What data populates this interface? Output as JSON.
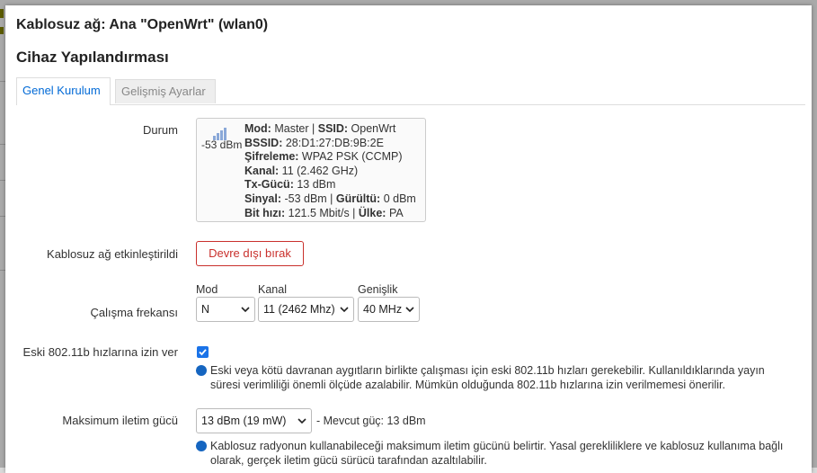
{
  "modal": {
    "title": "Kablosuz ağ: Ana \"OpenWrt\" (wlan0)",
    "section_title": "Cihaz Yapılandırması"
  },
  "tabs": [
    {
      "label": "Genel Kurulum",
      "active": true
    },
    {
      "label": "Gelişmiş Ayarlar",
      "active": false
    }
  ],
  "status": {
    "label": "Durum",
    "signal_dbm": "-53 dBm",
    "lines": [
      {
        "k1": "Mod:",
        "v1": " Master | ",
        "k2": "SSID:",
        "v2": " OpenWrt"
      },
      {
        "k1": "BSSID:",
        "v1": " 28:D1:27:DB:9B:2E",
        "k2": "",
        "v2": ""
      },
      {
        "k1": "Şifreleme:",
        "v1": " WPA2 PSK (CCMP)",
        "k2": "",
        "v2": ""
      },
      {
        "k1": "Kanal:",
        "v1": " 11 (2.462 GHz)",
        "k2": "",
        "v2": ""
      },
      {
        "k1": "Tx-Gücü:",
        "v1": " 13 dBm",
        "k2": "",
        "v2": ""
      },
      {
        "k1": "Sinyal:",
        "v1": " -53 dBm | ",
        "k2": "Gürültü:",
        "v2": " 0 dBm"
      },
      {
        "k1": "Bit hızı:",
        "v1": " 121.5 Mbit/s | ",
        "k2": "Ülke:",
        "v2": " PA"
      }
    ]
  },
  "enable": {
    "label": "Kablosuz ağ etkinleştirildi",
    "button_label": "Devre dışı bırak"
  },
  "frequency": {
    "label": "Çalışma frekansı",
    "mode_label": "Mod",
    "mode_value": "N",
    "channel_label": "Kanal",
    "channel_value": "11 (2462 Mhz)",
    "width_label": "Genişlik",
    "width_value": "40 MHz"
  },
  "legacy": {
    "label": "Eski 802.11b hızlarına izin ver",
    "checked": true,
    "help": "Eski veya kötü davranan aygıtların birlikte çalışması için eski 802.11b hızları gerekebilir. Kullanıldıklarında yayın süresi verimliliği önemli ölçüde azalabilir. Mümkün olduğunda 802.11b hızlarına izin verilmemesi önerilir."
  },
  "txpower": {
    "label": "Maksimum iletim gücü",
    "value": "13 dBm (19 mW)",
    "current_text": "- Mevcut güç: 13 dBm",
    "help": "Kablosuz radyonun kullanabileceği maksimum iletim gücünü belirtir. Yasal gerekliliklere ve kablosuz kullanıma bağlı olarak, gerçek iletim gücü sürücü tarafından azaltılabilir."
  },
  "colors": {
    "accent": "#0069d6",
    "danger": "#c9302c",
    "checkbox": "#1a73e8"
  },
  "icons": {
    "help": "question-circle-icon",
    "signal": "signal-bars-icon",
    "select_arrow": "chevron-down-icon"
  }
}
